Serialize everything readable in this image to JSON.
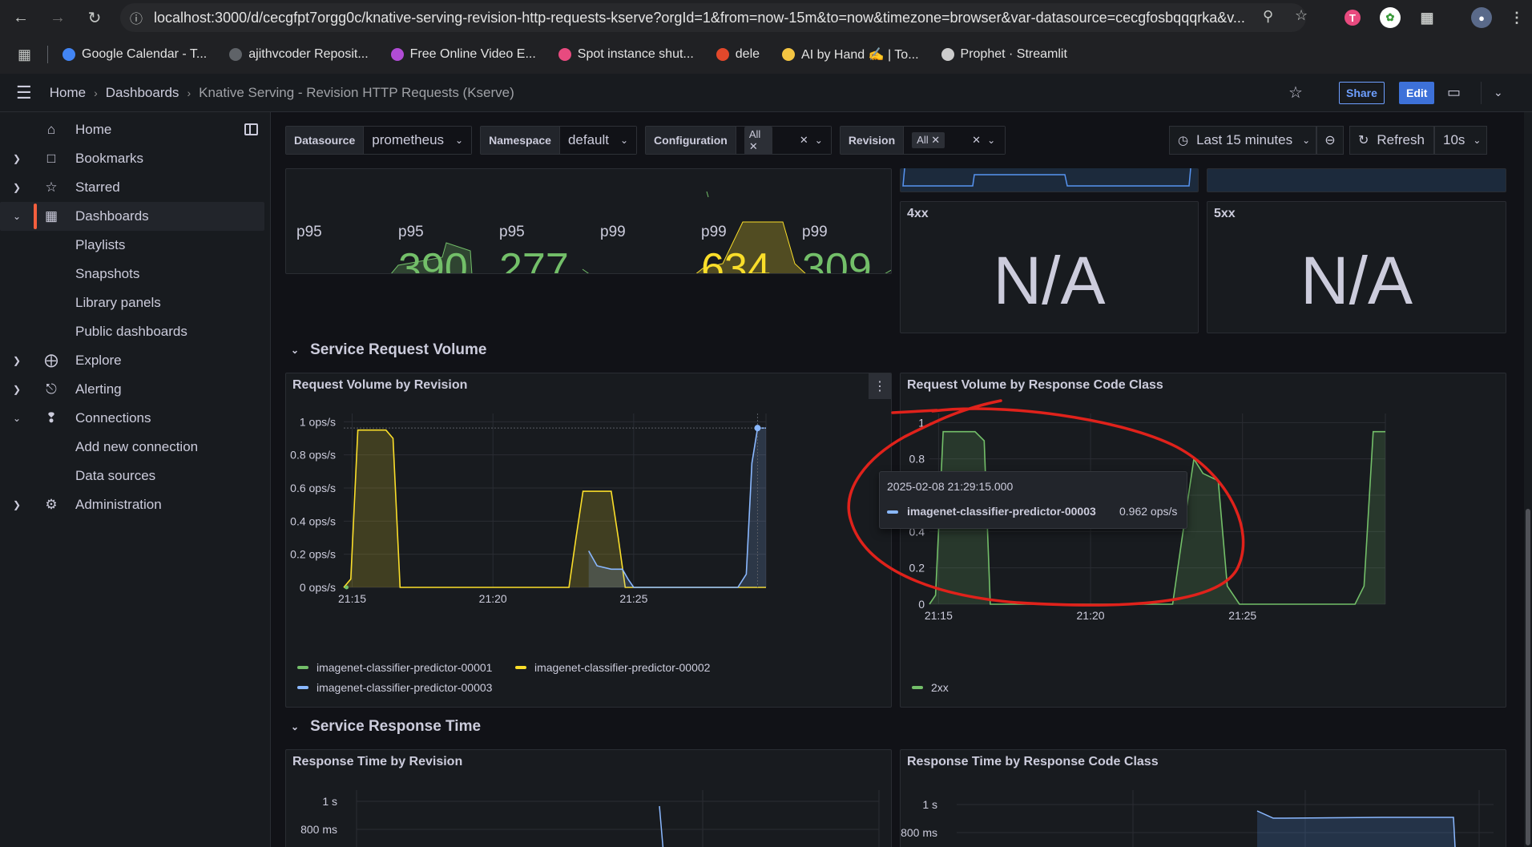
{
  "browser": {
    "url": "localhost:3000/d/cecgfpt7orgg0c/knative-serving-revision-http-requests-kserve?orgId=1&from=now-15m&to=now&timezone=browser&var-datasource=cecgfosbqqqrka&v...",
    "bookmarks": [
      {
        "label": "Google Calendar - T...",
        "color": "#4285f4"
      },
      {
        "label": "ajithvcoder Reposit...",
        "color": "#5f6368"
      },
      {
        "label": "Free Online Video E...",
        "color": "#b14cd6"
      },
      {
        "label": "Spot instance shut...",
        "color": "#e84a7f"
      },
      {
        "label": "dele",
        "color": "#e2482b"
      },
      {
        "label": "AI by Hand ✍️ | To...",
        "color": "#f4c542"
      },
      {
        "label": "Prophet · Streamlit",
        "color": "#cccccc"
      }
    ]
  },
  "header": {
    "breadcrumb": [
      "Home",
      "Dashboards",
      "Knative Serving - Revision HTTP Requests (Kserve)"
    ],
    "share_label": "Share",
    "edit_label": "Edit"
  },
  "sidebar": {
    "items": [
      {
        "label": "Home",
        "icon": "home-icon"
      },
      {
        "label": "Bookmarks",
        "icon": "bookmark-icon"
      },
      {
        "label": "Starred",
        "icon": "star-icon"
      },
      {
        "label": "Dashboards",
        "icon": "grid-icon"
      },
      {
        "label": "Playlists"
      },
      {
        "label": "Snapshots"
      },
      {
        "label": "Library panels"
      },
      {
        "label": "Public dashboards"
      },
      {
        "label": "Explore",
        "icon": "compass-icon"
      },
      {
        "label": "Alerting",
        "icon": "bell-icon"
      },
      {
        "label": "Connections",
        "icon": "connections-icon"
      },
      {
        "label": "Add new connection"
      },
      {
        "label": "Data sources"
      },
      {
        "label": "Administration",
        "icon": "cog-icon"
      }
    ]
  },
  "variables": {
    "datasource": {
      "label": "Datasource",
      "value": "prometheus"
    },
    "namespace": {
      "label": "Namespace",
      "value": "default"
    },
    "configuration": {
      "label": "Configuration",
      "value": "All"
    },
    "revision": {
      "label": "Revision",
      "value": "All"
    }
  },
  "time_range": {
    "label": "Last 15 minutes",
    "refresh_label": "Refresh",
    "refresh_interval": "10s"
  },
  "stats": {
    "labels": [
      "p95",
      "p95",
      "p95",
      "p99",
      "p99",
      "p99"
    ],
    "values": [
      "390",
      "277",
      "634",
      "309"
    ],
    "colors": {
      "green": "#73bf69",
      "yellow": "#fade2a"
    },
    "panel_4xx": {
      "title": "4xx",
      "value": "N/A"
    },
    "panel_5xx": {
      "title": "5xx",
      "value": "N/A"
    }
  },
  "rows": {
    "request_volume": "Service Request Volume",
    "response_time": "Service Response Time"
  },
  "panels": {
    "rv_by_revision": "Request Volume by Revision",
    "rv_by_code": "Request Volume by Response Code Class",
    "rt_by_revision": "Response Time by Revision",
    "rt_by_code": "Response Time by Response Code Class"
  },
  "tooltip": {
    "time": "2025-02-08 21:29:15.000",
    "series": "imagenet-classifier-predictor-00003",
    "value": "0.962 ops/s"
  },
  "chart_data": [
    {
      "type": "area",
      "title": "Request Volume by Revision",
      "x_ticks": [
        "21:15",
        "21:20",
        "21:25"
      ],
      "y_ticks": [
        "0 ops/s",
        "0.2 ops/s",
        "0.4 ops/s",
        "0.6 ops/s",
        "0.8 ops/s",
        "1 ops/s"
      ],
      "ylim": [
        0,
        1.05
      ],
      "xlim": [
        0,
        15
      ],
      "series": [
        {
          "name": "imagenet-classifier-predictor-00001",
          "color": "#73bf69",
          "x": [
            0,
            0.1
          ],
          "y": [
            0,
            0
          ]
        },
        {
          "name": "imagenet-classifier-predictor-00002",
          "color": "#fade2a",
          "x": [
            0,
            0.25,
            0.5,
            1.5,
            1.75,
            2.0,
            8.0,
            8.25,
            8.5,
            9.5,
            9.75,
            10.0,
            15
          ],
          "y": [
            0,
            0.05,
            0.95,
            0.95,
            0.9,
            0,
            0,
            0.3,
            0.58,
            0.58,
            0.3,
            0,
            0
          ]
        },
        {
          "name": "imagenet-classifier-predictor-00003",
          "color": "#8ab8ff",
          "x": [
            8.7,
            9.0,
            9.5,
            9.9,
            10.1,
            10.3,
            14.0,
            14.3,
            14.5,
            14.7,
            15
          ],
          "y": [
            0.22,
            0.13,
            0.11,
            0.11,
            0.05,
            0,
            0,
            0.08,
            0.75,
            0.962,
            0.962
          ]
        }
      ],
      "legend": "bottom"
    },
    {
      "type": "area",
      "title": "Request Volume by Response Code Class",
      "x_ticks": [
        "21:15",
        "21:20",
        "21:25"
      ],
      "y_ticks": [
        "0",
        "0.2",
        "0.4",
        "0.6",
        "0.8",
        "1"
      ],
      "ylim": [
        0,
        1.05
      ],
      "xlim": [
        0,
        15
      ],
      "series": [
        {
          "name": "2xx",
          "color": "#73bf69",
          "x": [
            0,
            0.2,
            0.45,
            1.5,
            1.8,
            2.0,
            8.0,
            8.3,
            8.7,
            9.0,
            9.5,
            9.8,
            10.2,
            14.0,
            14.3,
            14.6,
            15
          ],
          "y": [
            0,
            0.05,
            0.95,
            0.95,
            0.9,
            0,
            0,
            0.35,
            0.8,
            0.72,
            0.68,
            0.1,
            0,
            0,
            0.1,
            0.95,
            0.95
          ]
        }
      ],
      "legend": "bottom"
    },
    {
      "type": "line",
      "title": "Response Time by Revision",
      "y_ticks": [
        "800 ms",
        "1 s"
      ]
    },
    {
      "type": "line",
      "title": "Response Time by Response Code Class",
      "y_ticks": [
        "800 ms",
        "1 s"
      ]
    }
  ]
}
